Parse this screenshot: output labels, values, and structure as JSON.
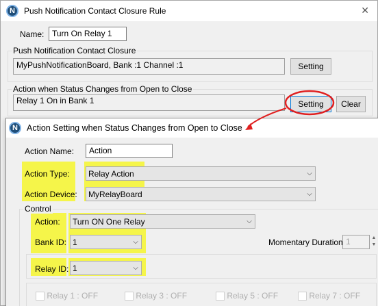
{
  "main_window": {
    "title": "Push Notification Contact Closure Rule",
    "close_glyph": "✕",
    "icon_letter": "N",
    "name_label": "Name:",
    "name_value": "Turn On Relay 1",
    "push_group_label": "Push Notification Contact Closure",
    "push_value": "MyPushNotificationBoard, Bank :1 Channel :1",
    "push_setting_btn": "Setting",
    "action_group_label": "Action when Status Changes from Open to Close",
    "action_value": "Relay 1 On in Bank 1",
    "action_setting_btn": "Setting",
    "clear_btn": "Clear"
  },
  "dialog": {
    "title": "Action Setting when Status Changes from Open to Close",
    "icon_letter": "N",
    "action_name_label": "Action Name:",
    "action_name_value": "Action",
    "action_type_label": "Action Type:",
    "action_type_value": "Relay Action",
    "action_device_label": "Action Device:",
    "action_device_value": "MyRelayBoard",
    "control_label": "Control",
    "action_label": "Action:",
    "action_value": "Turn ON One Relay",
    "bank_id_label": "Bank ID:",
    "bank_id_value": "1",
    "momentary_label": "Momentary Duration:",
    "momentary_value": "1",
    "relay_id_label": "Relay ID:",
    "relay_id_value": "1",
    "relay_checks": [
      {
        "label": "Relay 1 : OFF"
      },
      {
        "label": "Relay 3 : OFF"
      },
      {
        "label": "Relay 5 : OFF"
      },
      {
        "label": "Relay 7 : OFF"
      }
    ]
  },
  "colors": {
    "highlight": "#f5f54a",
    "annotation": "#e02020",
    "focus": "#0078d7"
  },
  "icons": {
    "app": "nexus-n-icon",
    "close": "close-icon",
    "dropdown": "chevron-down-icon",
    "spinner": "spin-arrows-icon"
  }
}
